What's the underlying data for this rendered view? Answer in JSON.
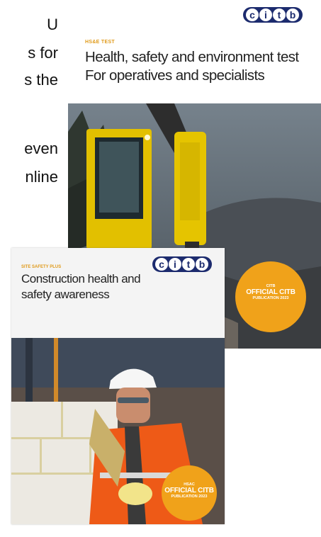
{
  "background_text": {
    "lines": [
      "U",
      "s for",
      "s the",
      "",
      "even",
      "nline"
    ]
  },
  "cover_operatives": {
    "logo_text": "citb",
    "series_label": "HS&E TEST",
    "title_line1": "Health, safety and environment test",
    "title_line2": "For operatives and specialists",
    "badge": {
      "line1": "CITB",
      "line2": "OFFICIAL CITB",
      "line3": "PUBLICATION 2023"
    }
  },
  "cover_awareness": {
    "logo_text": "citb",
    "series_label": "SITE SAFETY PLUS",
    "title_line1": "Construction health and",
    "title_line2": "safety awareness",
    "badge": {
      "line1": "HSAC",
      "line2": "OFFICIAL CITB",
      "line3": "PUBLICATION 2023"
    }
  },
  "colors": {
    "brand_navy": "#1c2b6e",
    "badge_orange": "#f0a21a",
    "series_orange": "#e09a1a"
  }
}
